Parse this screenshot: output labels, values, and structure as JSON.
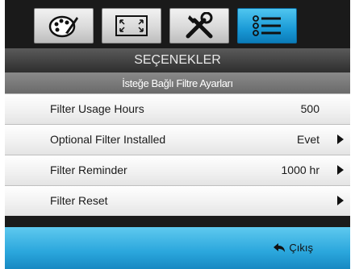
{
  "tabs": [
    {
      "icon": "palette-icon",
      "active": false
    },
    {
      "icon": "screen-resize-icon",
      "active": false
    },
    {
      "icon": "tools-icon",
      "active": false
    },
    {
      "icon": "list-menu-icon",
      "active": true
    }
  ],
  "menu": {
    "title": "SEÇENEKLER",
    "subtitle": "İsteğe Bağlı Filtre Ayarları",
    "rows": [
      {
        "label": "Filter Usage Hours",
        "value": "500",
        "has_arrow": false
      },
      {
        "label": "Optional Filter Installed",
        "value": "Evet",
        "has_arrow": true
      },
      {
        "label": "Filter Reminder",
        "value": "1000 hr",
        "has_arrow": true
      },
      {
        "label": "Filter Reset",
        "value": "",
        "has_arrow": true
      }
    ]
  },
  "footer": {
    "exit_label": "Çıkış",
    "exit_icon": "back-arrow-icon"
  },
  "colors": {
    "accent": "#1a9ad6",
    "background": "#1a1a1a"
  }
}
